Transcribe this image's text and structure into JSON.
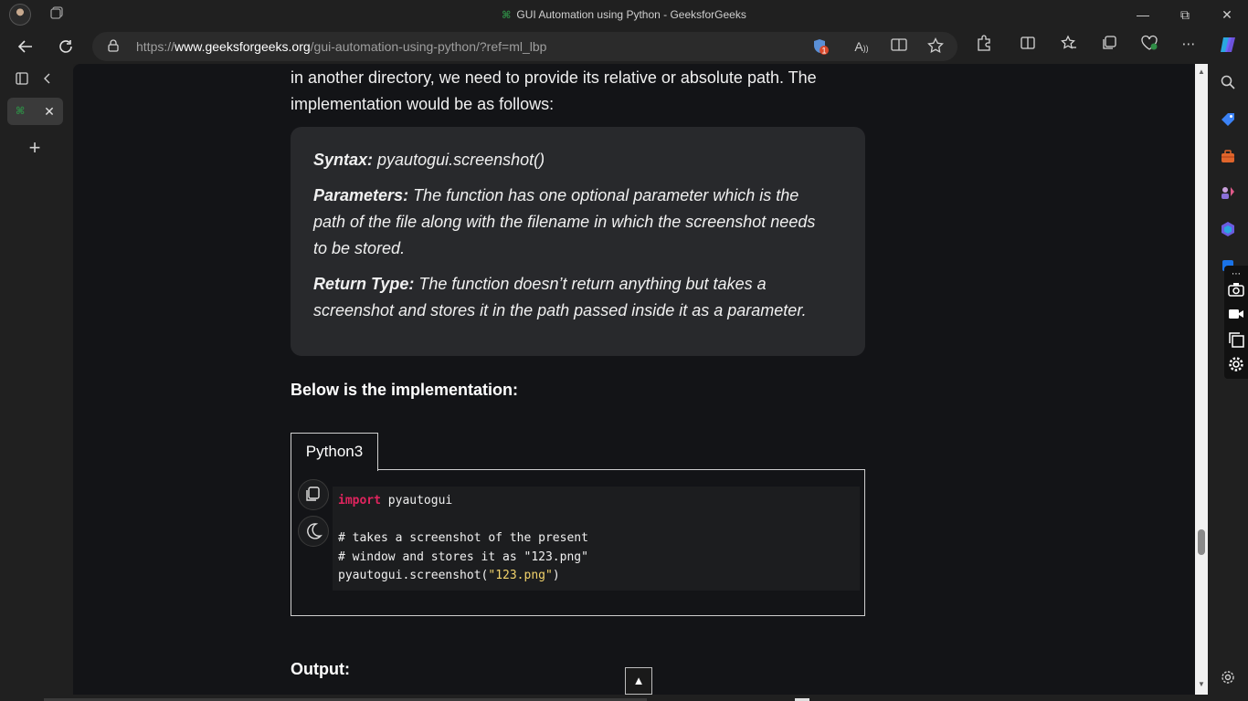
{
  "window": {
    "title": "GUI Automation using Python - GeeksforGeeks",
    "favicon_text": "⌘",
    "controls": {
      "minimize": "—",
      "restore": "⧉",
      "close": "✕"
    }
  },
  "address_bar": {
    "url_prefix": "https://",
    "url_domain": "www.geeksforgeeks.org",
    "url_path": "/gui-automation-using-python/?ref=ml_lbp",
    "badge_count": "1"
  },
  "vertical_tabs": {
    "tab_favicon": "⌘",
    "close_glyph": "✕",
    "new_tab_glyph": "+"
  },
  "article": {
    "intro_line1": "in another directory, we need to provide its relative or absolute path. The",
    "intro_line2": "implementation would be as follows:",
    "syntax_label": "Syntax:",
    "syntax_value": " pyautogui.screenshot()",
    "params_label": "Parameters:",
    "params_line1": " The function has one optional parameter which is the",
    "params_line2": "path of the file along with the filename in which the screenshot needs",
    "params_line3": "to be stored.",
    "return_label": "Return Type:",
    "return_line1": " The function doesn’t return anything but takes a",
    "return_line2": "screenshot and stores it in the path passed inside it as a parameter.",
    "below_heading": "Below is the implementation:",
    "output_heading": "Output:"
  },
  "code": {
    "tab_label": "Python3",
    "line1_kw": "import",
    "line1_rest": " pyautogui",
    "line2": "# takes a screenshot of the present",
    "line3": "# window and stores it as \"123.png\"",
    "line4_pre": "pyautogui.screenshot(",
    "line4_str": "\"123.png\"",
    "line4_post": ")"
  },
  "scroll_top_glyph": "▲",
  "colors": {
    "brand_green": "#2f8d46",
    "keyword": "#e0245e",
    "string": "#f2d36b",
    "comment": "#8a8a8a"
  }
}
